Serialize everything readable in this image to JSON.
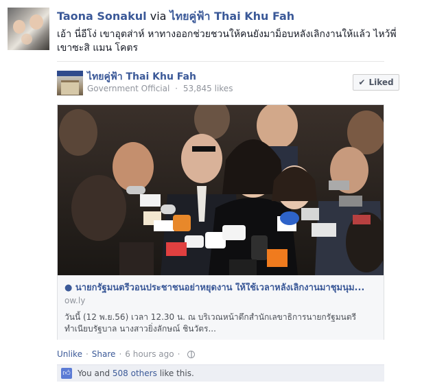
{
  "post": {
    "author": "Taona Sonakul",
    "via": "via",
    "page_link": "ไทยคู่ฟ้า Thai Khu Fah",
    "message": "เอ้า นี่อีโง่ เขาอุตส่าห์ หาทางออกช่วยชวนให้คนยังมาม็อบหลังเลิกงานให้แล้ว ไหว้พี่เขาซะสิ แมน โคตร"
  },
  "page": {
    "name": "ไทยคู่ฟ้า Thai Khu Fah",
    "category": "Government Official",
    "separator": "·",
    "likes": "53,845 likes",
    "liked_label": "Liked",
    "liked_icon": "checkmark-icon"
  },
  "link": {
    "title": "● นายกรัฐมนตรีวอนประชาชนอย่าหยุดงาน ให้ใช้เวลาหลังเลิกงานมาชุมนุม...",
    "domain": "ow.ly",
    "description": "วันนี้ (12 พ.ย.56) เวลา 12.30 น. ณ บริเวณหน้าตึกสำนักเลขาธิการนายกรัฐมนตรี ทำเนียบรัฐบาล นางสาวยิ่งลักษณ์ ชินวัตร..."
  },
  "actions": {
    "unlike": "Unlike",
    "share": "Share",
    "dot": "·",
    "time": "6 hours ago",
    "privacy_icon": "globe-icon"
  },
  "likes_bar": {
    "prefix": "You and",
    "others": "508 others",
    "suffix": "like this.",
    "icon": "thumbs-up-icon"
  },
  "colors": {
    "link_blue": "#3b5998",
    "meta_gray": "#90949c",
    "likes_bg": "#edeff4"
  }
}
